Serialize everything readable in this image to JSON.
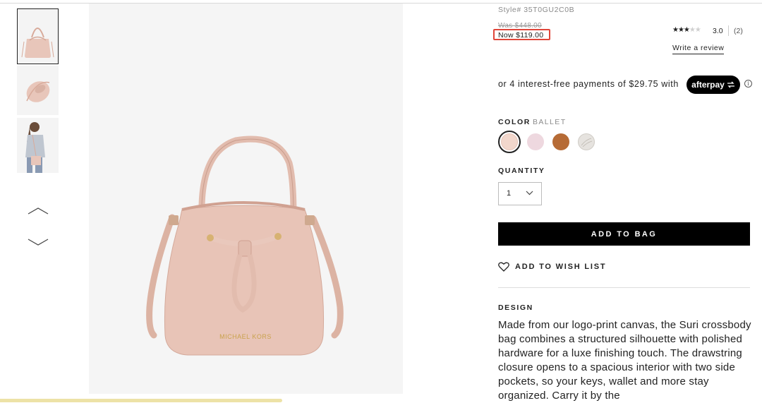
{
  "product": {
    "style_number": "Style# 35T0GU2C0B",
    "was_price": "Was $448.00",
    "now_price": "Now $119.00"
  },
  "rating": {
    "value": 3.0,
    "value_label": "3.0",
    "review_count": "(2)",
    "write_review_label": "Write a review"
  },
  "afterpay": {
    "text": "or 4 interest-free payments of $29.75 with",
    "badge_label": "afterpay"
  },
  "color": {
    "label": "COLOR",
    "selected": "BALLET",
    "swatches": [
      "#f2d7cc",
      "#eed8df",
      "#b66b36",
      "#e6e3df"
    ]
  },
  "quantity": {
    "label": "QUANTITY",
    "value": "1"
  },
  "actions": {
    "add_to_bag": "ADD TO BAG",
    "wish_list": "ADD TO WISH LIST"
  },
  "design": {
    "label": "DESIGN",
    "text": "Made from our logo-print canvas, the Suri crossbody bag combines a structured silhouette with polished hardware for a luxe finishing touch. The drawstring closure opens to a spacious interior with two side pockets, so your keys, wallet and more stay organized. Carry it by the"
  },
  "image": {
    "brand_mark": "MICHAEL KORS"
  },
  "colors": {
    "accent": "#000000",
    "price_highlight": "#e0463a",
    "bag_pink": "#e5c1b5"
  }
}
